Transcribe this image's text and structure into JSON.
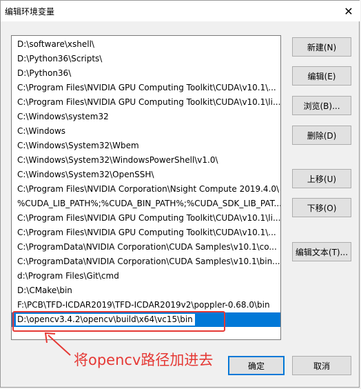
{
  "window": {
    "title": "编辑环境变量",
    "close_glyph": "✕"
  },
  "paths": [
    "D:\\software\\xshell\\",
    "D:\\Python36\\Scripts\\",
    "D:\\Python36\\",
    "C:\\Program Files\\NVIDIA GPU Computing Toolkit\\CUDA\\v10.1\\...",
    "C:\\Program Files\\NVIDIA GPU Computing Toolkit\\CUDA\\v10.1\\li...",
    "C:\\Windows\\system32",
    "C:\\Windows",
    "C:\\Windows\\System32\\Wbem",
    "C:\\Windows\\System32\\WindowsPowerShell\\v1.0\\",
    "C:\\Windows\\System32\\OpenSSH\\",
    "C:\\Program Files\\NVIDIA Corporation\\Nsight Compute 2019.4.0\\",
    "%CUDA_LIB_PATH%;%CUDA_BIN_PATH%;%CUDA_SDK_LIB_PAT...",
    "C:\\Program Files\\NVIDIA GPU Computing Toolkit\\CUDA\\v10.1\\li...",
    "C:\\Program Files\\NVIDIA GPU Computing Toolkit\\CUDA\\v10.1\\...",
    "C:\\ProgramData\\NVIDIA Corporation\\CUDA Samples\\v10.1\\co...",
    "C:\\ProgramData\\NVIDIA Corporation\\CUDA Samples\\v10.1\\bin...",
    "d:\\Program Files\\Git\\cmd",
    "D:\\CMake\\bin",
    "F:\\PCB\\TFD-ICDAR2019\\TFD-ICDAR2019v2\\poppler-0.68.0\\bin"
  ],
  "editing_value": "D:\\opencv3.4.2\\opencv\\build\\x64\\vc15\\bin",
  "buttons": {
    "new": "新建(N)",
    "edit": "编辑(E)",
    "browse": "浏览(B)...",
    "delete": "删除(D)",
    "move_up": "上移(U)",
    "move_down": "下移(O)",
    "edit_text": "编辑文本(T)...",
    "ok": "确定",
    "cancel": "取消"
  },
  "annotation": {
    "text": "将opencv路径加进去",
    "color": "#e53935"
  },
  "colors": {
    "selection": "#0078d7",
    "background": "#f0f0f0"
  }
}
